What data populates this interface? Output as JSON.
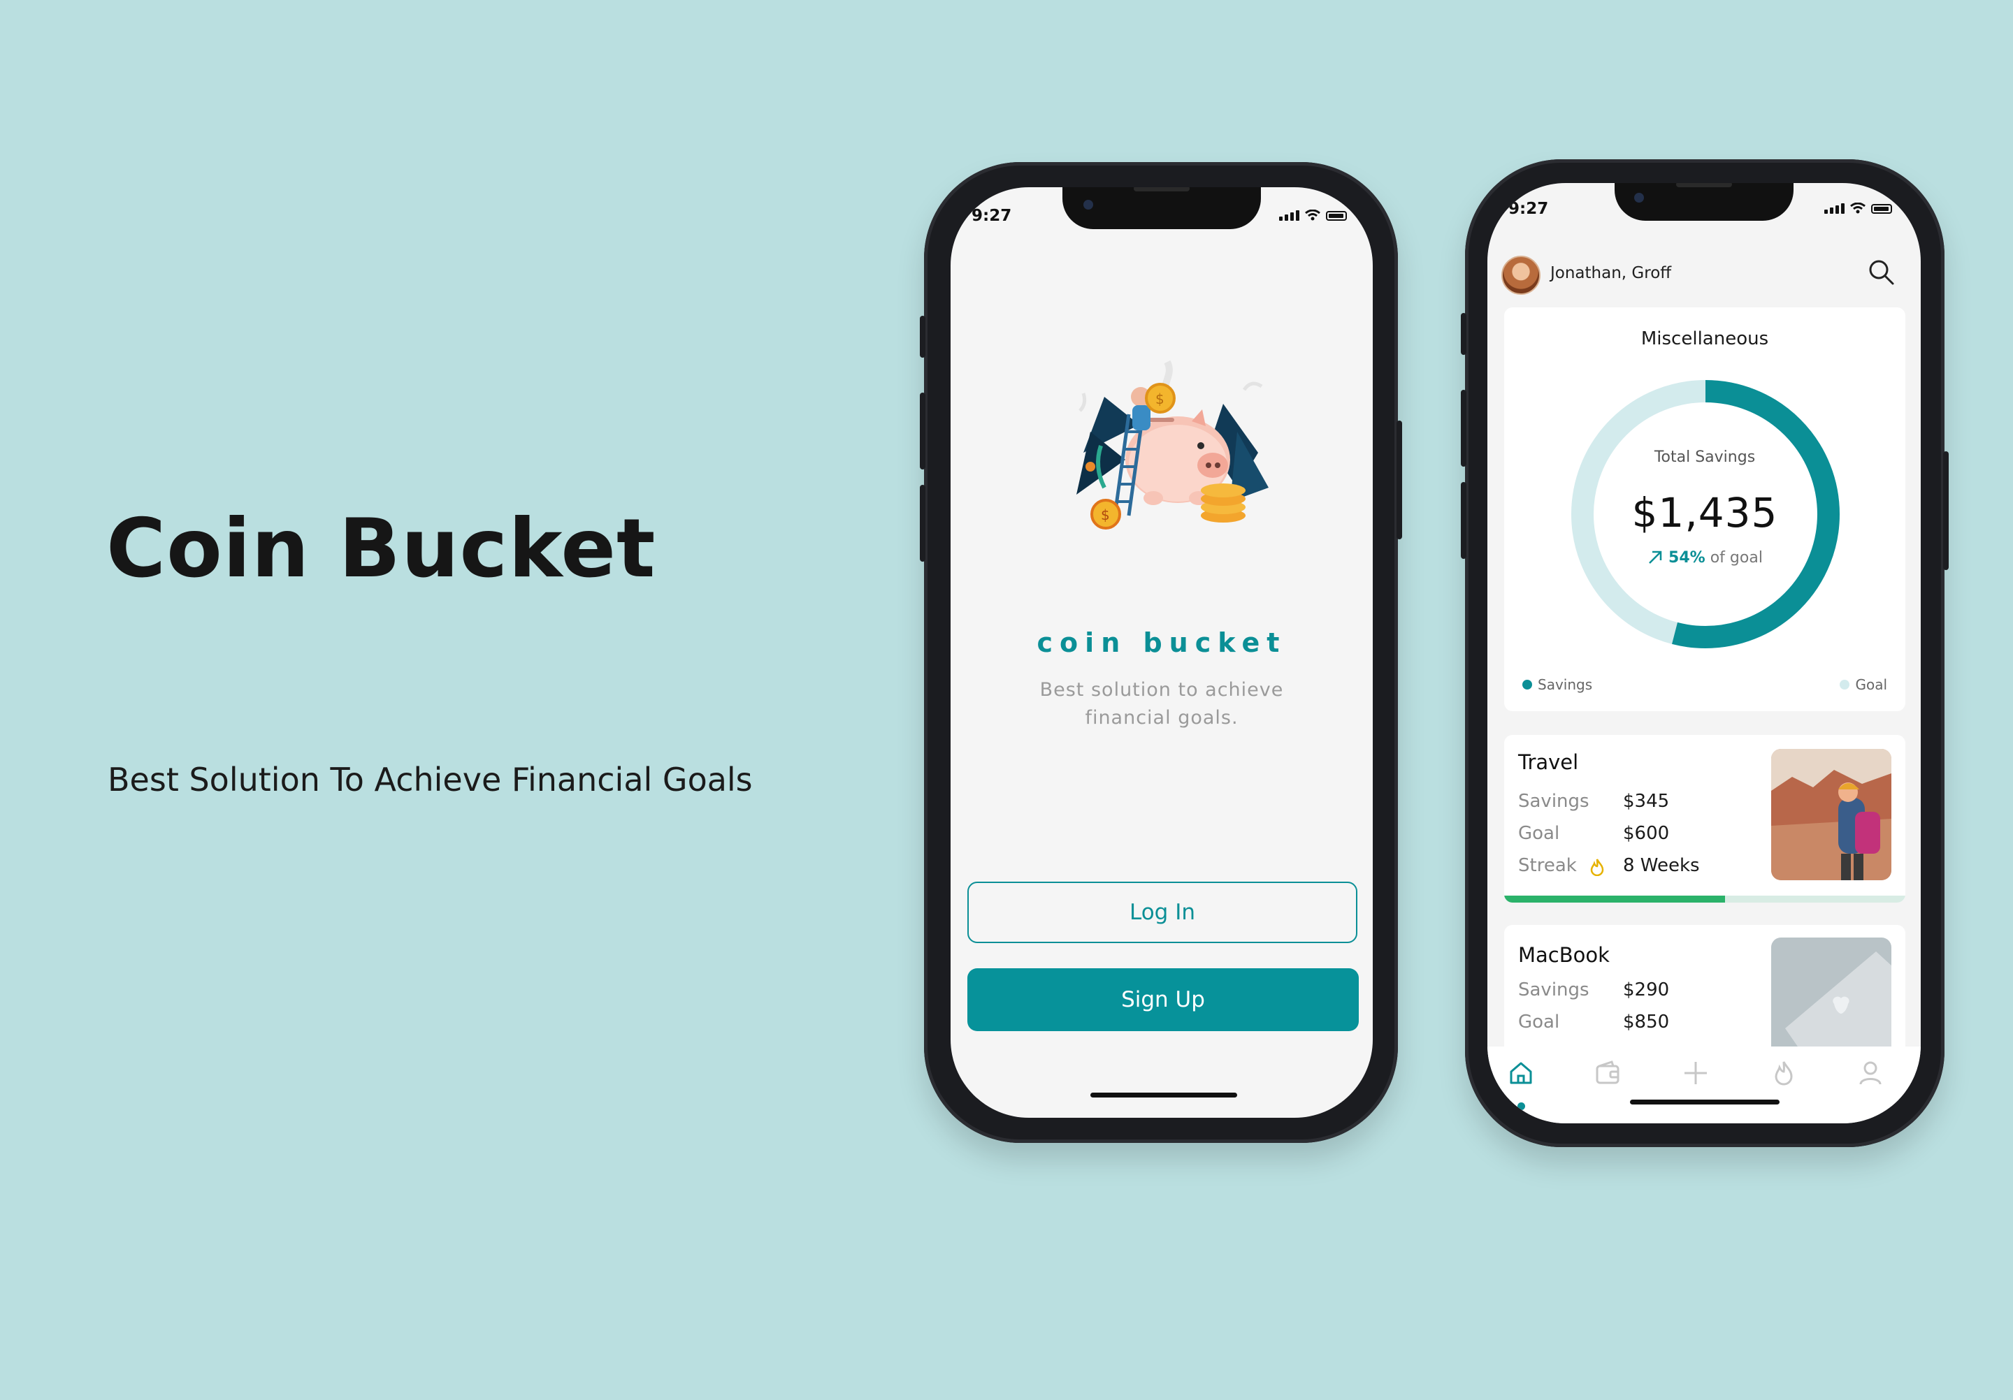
{
  "hero": {
    "title": "Coin Bucket",
    "subtitle": "Best Solution To Achieve Financial Goals"
  },
  "phone1": {
    "status_time": "9:27",
    "brand": "coin bucket",
    "tagline": "Best solution to achieve financial goals.",
    "login_label": "Log In",
    "signup_label": "Sign Up"
  },
  "phone2": {
    "status_time": "9:27",
    "user_name": "Jonathan, Groff",
    "summary": {
      "title": "Miscellaneous",
      "total_label": "Total Savings",
      "total_value": "$1,435",
      "pct": "54%",
      "pct_suffix": "of goal",
      "legend_savings": "Savings",
      "legend_goal": "Goal",
      "progress_fraction": 0.54
    },
    "goals": [
      {
        "title": "Travel",
        "savings_label": "Savings",
        "savings_value": "$345",
        "goal_label": "Goal",
        "goal_value": "$600",
        "streak_label": "Streak",
        "streak_value": "8 Weeks",
        "progress_fraction": 0.55
      },
      {
        "title": "MacBook",
        "savings_label": "Savings",
        "savings_value": "$290",
        "goal_label": "Goal",
        "goal_value": "$850"
      }
    ],
    "tabs": [
      "home-icon",
      "wallet-icon",
      "plus-icon",
      "flame-icon",
      "profile-icon"
    ],
    "active_tab": "home-icon"
  },
  "colors": {
    "background": "#badfe0",
    "accent": "#0b8f96",
    "accent_light": "#d3ebed",
    "progress_green": "#2bb26a",
    "streak_yellow": "#e6b200"
  }
}
